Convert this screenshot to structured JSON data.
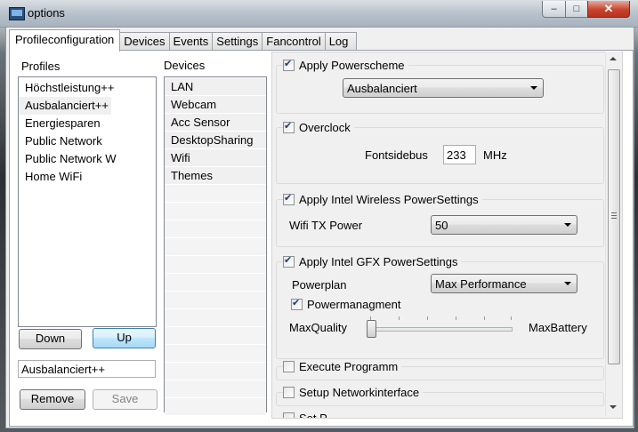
{
  "window": {
    "title": "options",
    "close_glyph": "✕",
    "min_glyph": "–",
    "max_glyph": "□"
  },
  "tabs": [
    "Profileconfiguration",
    "Devices",
    "Events",
    "Settings",
    "Fancontrol",
    "Log"
  ],
  "active_tab": "Profileconfiguration",
  "profiles": {
    "label": "Profiles",
    "items": [
      "Höchstleistung++",
      "Ausbalanciert++",
      "Energiesparen",
      "Public Network",
      "Public Network W",
      "Home WiFi"
    ],
    "selected": "Ausbalanciert++"
  },
  "devices": {
    "label": "Devices",
    "items": [
      "LAN",
      "Webcam",
      "Acc Sensor",
      "DesktopSharing",
      "Wifi",
      "Themes"
    ]
  },
  "buttons": {
    "down": "Down",
    "up": "Up",
    "remove": "Remove",
    "save": "Save"
  },
  "profile_name_value": "Ausbalanciert++",
  "settings": {
    "powerscheme": {
      "label": "Apply Powerscheme",
      "checked": true,
      "value": "Ausbalanciert"
    },
    "overclock": {
      "label": "Overclock",
      "checked": true,
      "fsb_label": "Fontsidebus",
      "fsb_value": "233",
      "unit": "MHz"
    },
    "wireless": {
      "label": "Apply Intel Wireless PowerSettings",
      "checked": true,
      "tx_label": "Wifi TX Power",
      "tx_value": "50"
    },
    "gfx": {
      "label": "Apply Intel GFX PowerSettings",
      "checked": true,
      "powerplan_label": "Powerplan",
      "powerplan_value": "Max Performance",
      "powermgmt_label": "Powermanagment",
      "powermgmt_checked": true,
      "slider_min": "MaxQuality",
      "slider_max": "MaxBattery",
      "slider_value": 0.0
    },
    "execute": {
      "label": "Execute Programm",
      "checked": false
    },
    "network": {
      "label": "Setup Networkinterface",
      "checked": false
    },
    "partial": {
      "label": "Set P",
      "checked": false
    }
  }
}
